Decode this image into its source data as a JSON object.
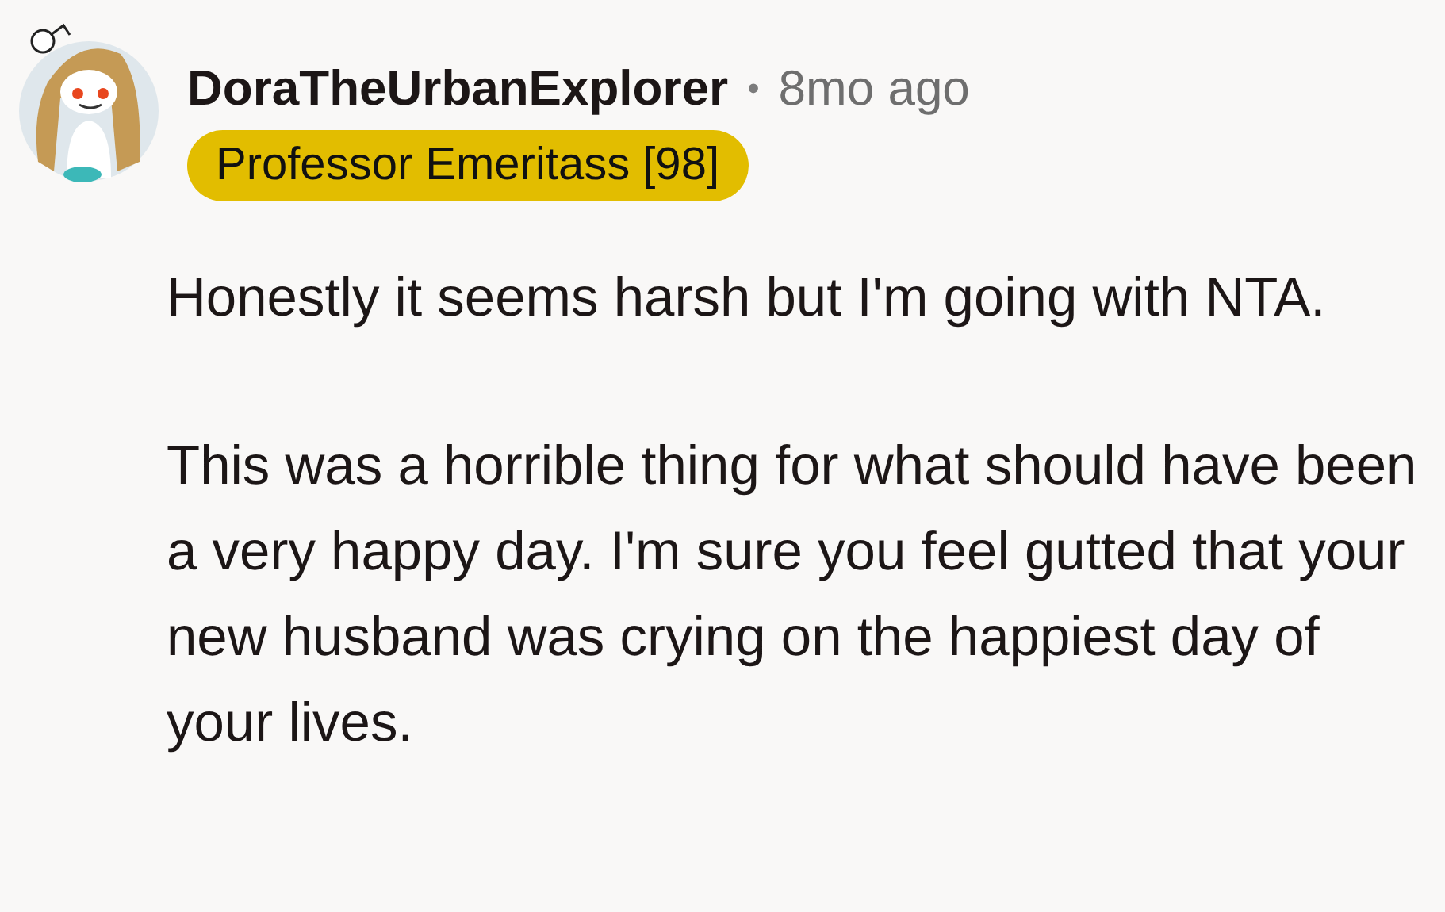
{
  "comment": {
    "author": "DoraTheUrbanExplorer",
    "separator": "•",
    "time": "8mo ago",
    "flair": {
      "text": "Professor Emeritass [98]",
      "color": "#e2bd00"
    },
    "paragraphs": [
      "Honestly it seems harsh but I'm going with NTA.",
      "This was a horrible thing for what should have been a very happy day. I'm sure you feel gutted that your new husband was crying on the happiest day of your lives."
    ]
  }
}
